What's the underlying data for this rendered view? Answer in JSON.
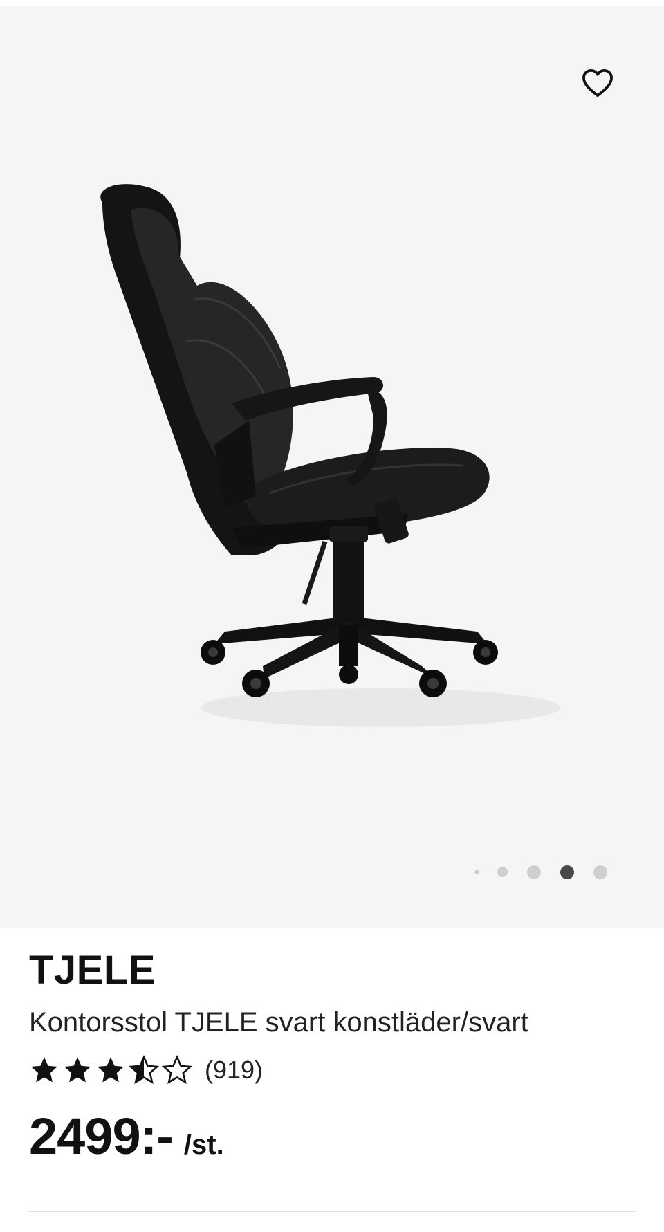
{
  "gallery": {
    "favorite_icon": "heart-outline-icon",
    "image_alt": "Kontorsstol TJELE svart konstläder/svart",
    "dots_total": 5,
    "active_dot_index": 3
  },
  "product": {
    "name": "TJELE",
    "description": "Kontorsstol TJELE svart konstläder/svart",
    "rating_value": 3.5,
    "rating_max": 5,
    "rating_count": "(919)",
    "price": "2499:-",
    "price_unit": "/st."
  },
  "colors": {
    "gallery_background": "#f5f5f5",
    "active_dot": "#484848",
    "inactive_dot": "#cfcfcf",
    "text": "#111111"
  }
}
